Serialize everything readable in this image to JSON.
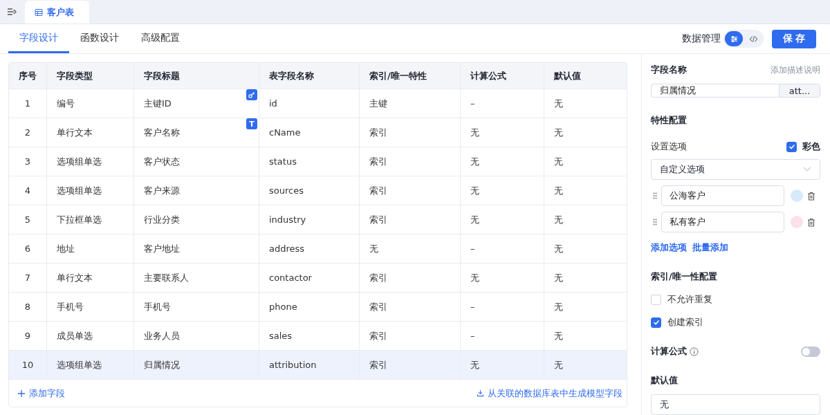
{
  "doc_tab": {
    "label": "客户表",
    "selected": true
  },
  "tabs": [
    {
      "label": "字段设计",
      "selected": true
    },
    {
      "label": "函数设计",
      "selected": false
    },
    {
      "label": "高级配置",
      "selected": false
    }
  ],
  "data_manage": {
    "label": "数据管理",
    "modes": [
      {
        "kind": "settings",
        "selected": true
      },
      {
        "kind": "code",
        "selected": false
      }
    ]
  },
  "save_button": "保 存",
  "table": {
    "columns": [
      "序号",
      "字段类型",
      "字段标题",
      "表字段名称",
      "索引/唯一特性",
      "计算公式",
      "默认值"
    ],
    "rows": [
      {
        "cells": [
          "1",
          "编号",
          "主键ID",
          "id",
          "主键",
          "–",
          "无"
        ],
        "badge": {
          "kind": "key"
        },
        "selected": false
      },
      {
        "cells": [
          "2",
          "单行文本",
          "客户名称",
          "cName",
          "索引",
          "无",
          "无"
        ],
        "badge": {
          "kind": "text",
          "label": "T"
        },
        "selected": false
      },
      {
        "cells": [
          "3",
          "选项组单选",
          "客户状态",
          "status",
          "索引",
          "无",
          "无"
        ],
        "selected": false
      },
      {
        "cells": [
          "4",
          "选项组单选",
          "客户来源",
          "sources",
          "索引",
          "无",
          "无"
        ],
        "selected": false
      },
      {
        "cells": [
          "5",
          "下拉框单选",
          "行业分类",
          "industry",
          "索引",
          "无",
          "无"
        ],
        "selected": false
      },
      {
        "cells": [
          "6",
          "地址",
          "客户地址",
          "address",
          "无",
          "–",
          "无"
        ],
        "selected": false
      },
      {
        "cells": [
          "7",
          "单行文本",
          "主要联系人",
          "contactor",
          "索引",
          "无",
          "无"
        ],
        "selected": false
      },
      {
        "cells": [
          "8",
          "手机号",
          "手机号",
          "phone",
          "索引",
          "–",
          "无"
        ],
        "selected": false
      },
      {
        "cells": [
          "9",
          "成员单选",
          "业务人员",
          "sales",
          "索引",
          "–",
          "无"
        ],
        "selected": false
      },
      {
        "cells": [
          "10",
          "选项组单选",
          "归属情况",
          "attribution",
          "索引",
          "无",
          "无"
        ],
        "selected": true
      }
    ]
  },
  "add_field": "添加字段",
  "generate_link": "从关联的数据库表中生成模型字段",
  "panel": {
    "field_name_label": "字段名称",
    "add_desc": "添加描述说明",
    "field_name_value": "归属情况",
    "field_key_value": "att...",
    "feature_title": "特性配置",
    "options_label": "设置选项",
    "colorful": {
      "label": "彩色",
      "checked": true
    },
    "option_source": "自定义选项",
    "options": [
      {
        "label": "公海客户",
        "color": "#d6eafc"
      },
      {
        "label": "私有客户",
        "color": "#fde0e8"
      }
    ],
    "add_option": "添加选项",
    "batch_add": "批量添加",
    "index_title": "索引/唯一性配置",
    "index_checks": [
      {
        "label": "不允许重复",
        "checked": false
      },
      {
        "label": "创建索引",
        "checked": true
      }
    ],
    "formula_label": "计算公式",
    "formula_on": false,
    "default_label": "默认值",
    "default_value": "无"
  }
}
